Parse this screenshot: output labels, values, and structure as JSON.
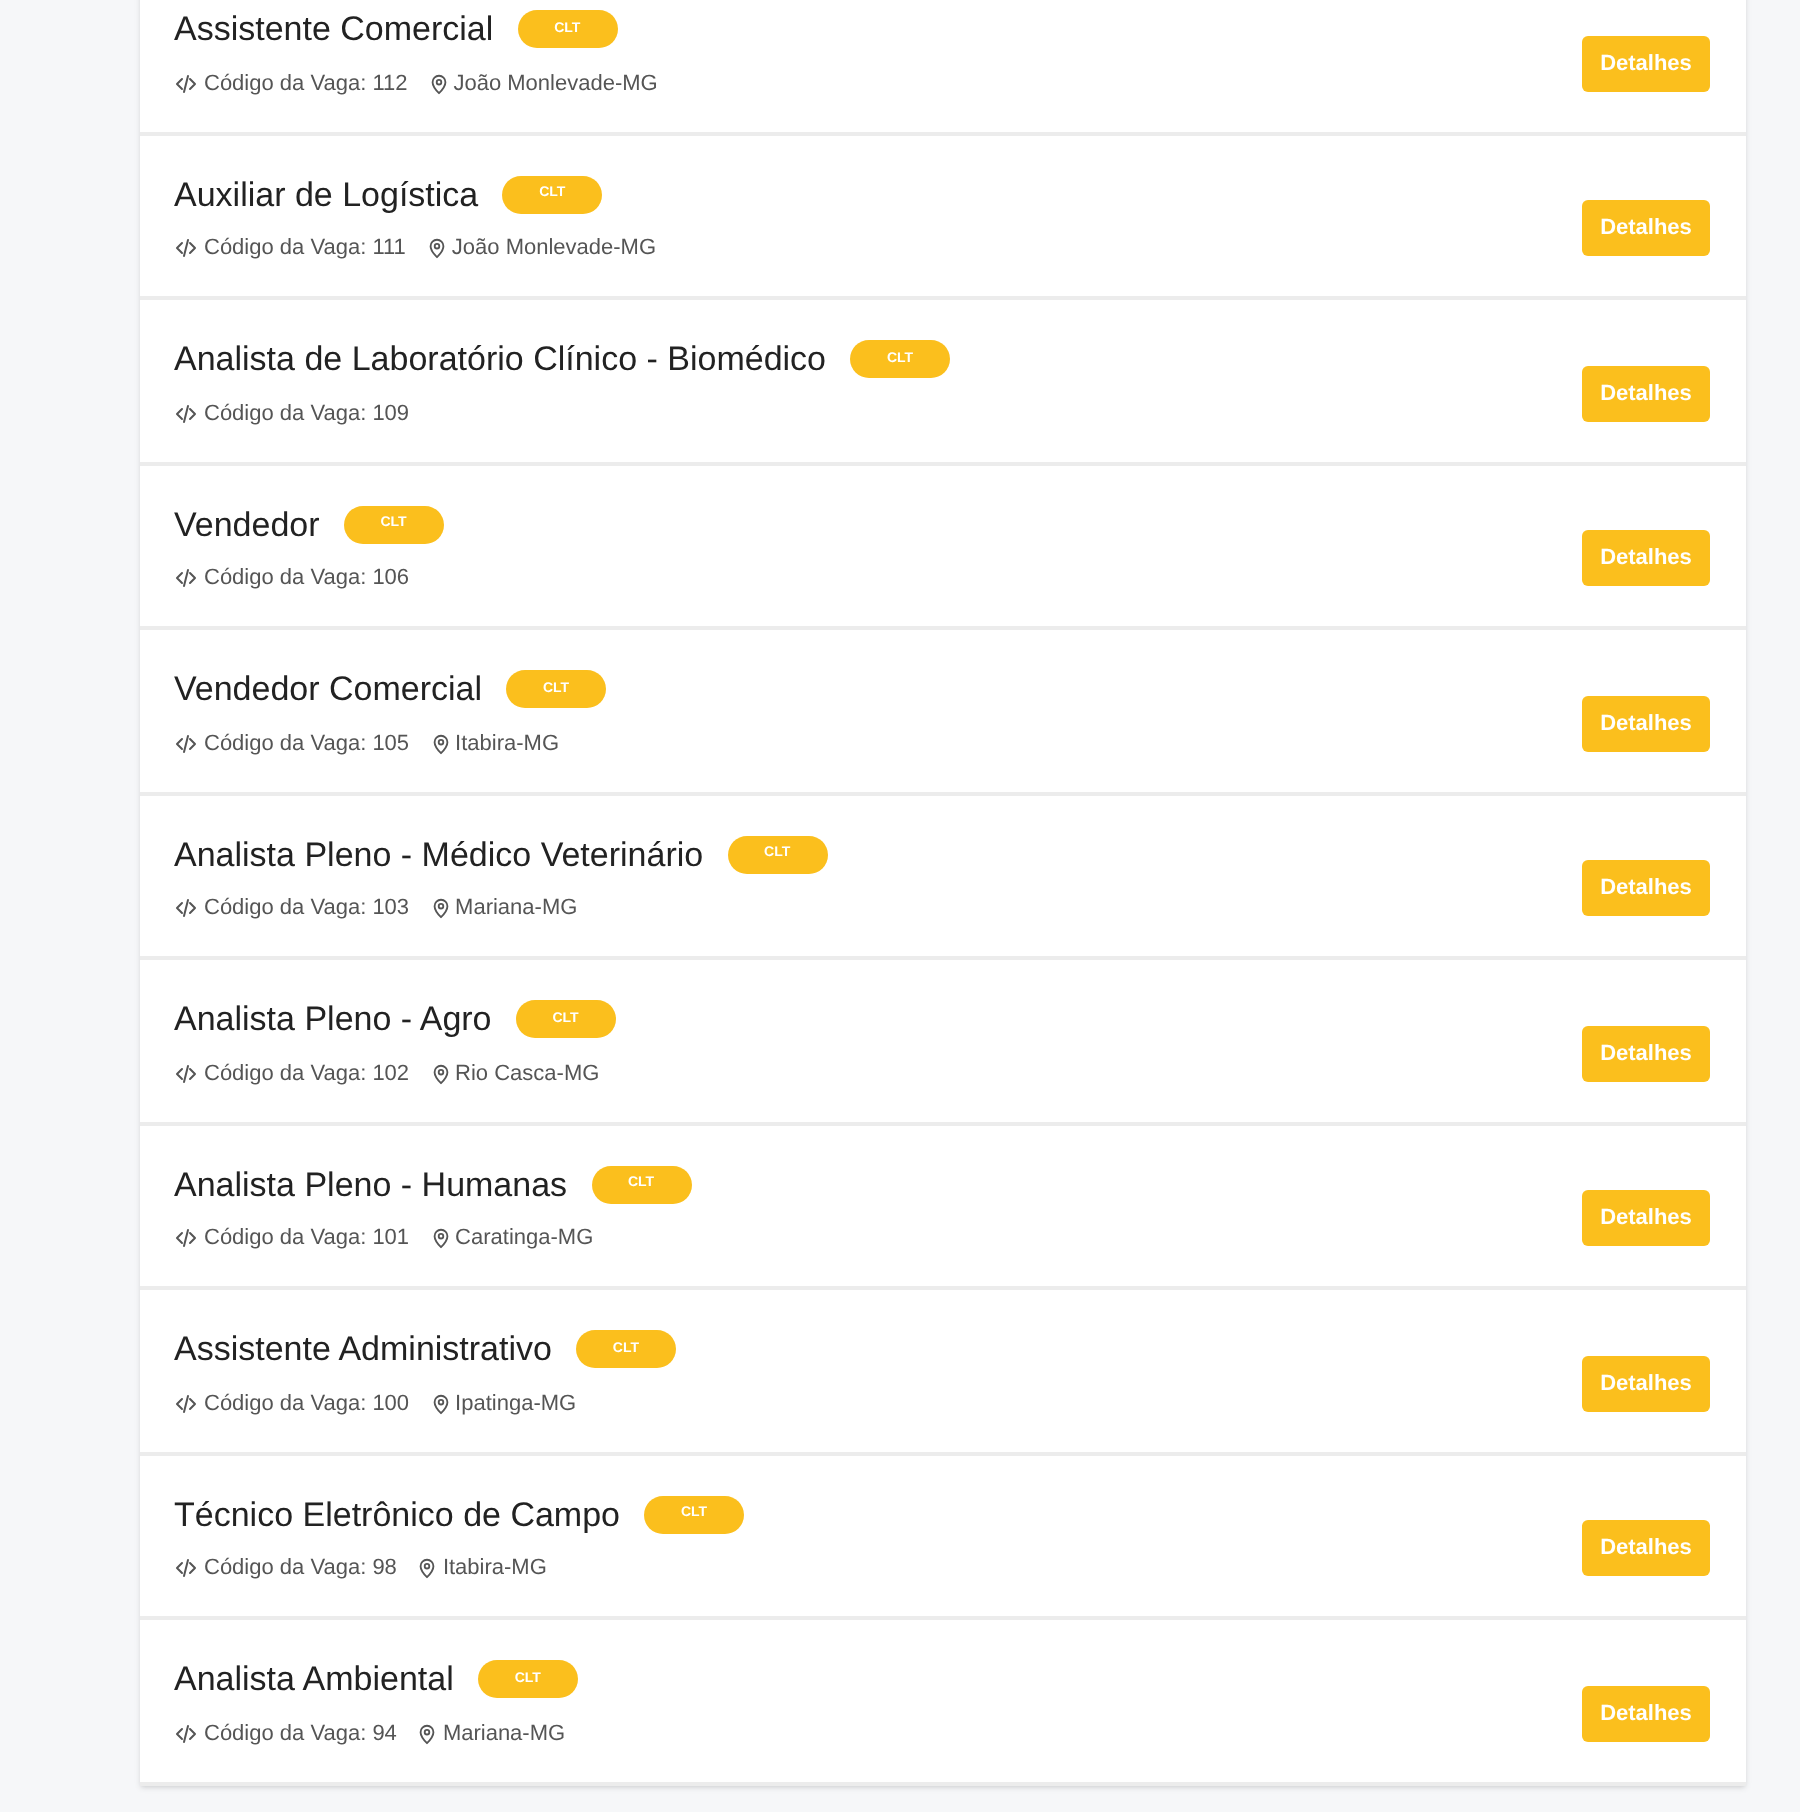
{
  "jobs": [
    {
      "title": "Assistente Comercial",
      "badge": "CLT",
      "code": "Código da Vaga: 112",
      "location": "João Monlevade-MG",
      "button": "Detalhes"
    },
    {
      "title": "Auxiliar de Logística",
      "badge": "CLT",
      "code": "Código da Vaga: 111",
      "location": "João Monlevade-MG",
      "button": "Detalhes"
    },
    {
      "title": "Analista de Laboratório Clínico - Biomédico",
      "badge": "CLT",
      "code": "Código da Vaga: 109",
      "button": "Detalhes"
    },
    {
      "title": "Vendedor",
      "badge": "CLT",
      "code": "Código da Vaga: 106",
      "button": "Detalhes"
    },
    {
      "title": "Vendedor Comercial",
      "badge": "CLT",
      "code": "Código da Vaga: 105",
      "location": "Itabira-MG",
      "button": "Detalhes"
    },
    {
      "title": "Analista Pleno - Médico Veterinário",
      "badge": "CLT",
      "code": "Código da Vaga: 103",
      "location": "Mariana-MG",
      "button": "Detalhes"
    },
    {
      "title": "Analista Pleno - Agro",
      "badge": "CLT",
      "code": "Código da Vaga: 102",
      "location": "Rio Casca-MG",
      "button": "Detalhes"
    },
    {
      "title": "Analista Pleno - Humanas",
      "badge": "CLT",
      "code": "Código da Vaga: 101",
      "location": "Caratinga-MG",
      "button": "Detalhes"
    },
    {
      "title": "Assistente Administrativo",
      "badge": "CLT",
      "code": "Código da Vaga: 100",
      "location": "Ipatinga-MG",
      "button": "Detalhes"
    },
    {
      "title": "Técnico Eletrônico de Campo",
      "badge": "CLT",
      "code": "Código da Vaga: 98",
      "location": "Itabira-MG",
      "button": "Detalhes"
    },
    {
      "title": "Analista Ambiental",
      "badge": "CLT",
      "code": "Código da Vaga: 94",
      "location": "Mariana-MG",
      "button": "Detalhes"
    }
  ]
}
